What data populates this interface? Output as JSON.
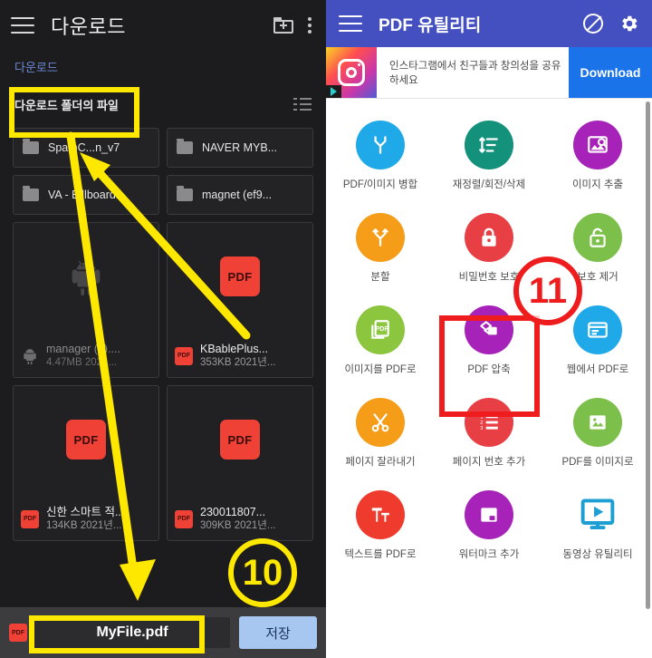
{
  "left_panel": {
    "appbar": {
      "title": "다운로드",
      "menu_icon": "hamburger-icon",
      "new_folder_icon": "new-folder-icon",
      "overflow_icon": "more-vertical-icon"
    },
    "breadcrumb": "다운로드",
    "subheader": {
      "label": "다운로드 폴더의 파일",
      "view_toggle_icon": "list-view-icon"
    },
    "folders": [
      {
        "name": "SpamC...n_v7"
      },
      {
        "name": "NAVER MYB..."
      },
      {
        "name": "VA - Billboard..."
      },
      {
        "name": "magnet (ef9..."
      }
    ],
    "files": [
      {
        "name": "manager (1)....",
        "meta": "4.47MB 2021...",
        "type": "apk",
        "dim": true
      },
      {
        "name": "KBablePlus...",
        "meta": "353KB 2021년...",
        "type": "pdf",
        "dim": false
      },
      {
        "name": "신한 스마트 적...",
        "meta": "134KB 2021년...",
        "type": "pdf",
        "dim": false
      },
      {
        "name": "230011807...",
        "meta": "309KB 2021년...",
        "type": "pdf",
        "dim": false
      }
    ],
    "save_bar": {
      "file_icon": "pdf-file-icon",
      "filename_value": "MyFile.pdf",
      "save_label": "저장"
    }
  },
  "right_panel": {
    "appbar": {
      "title": "PDF 유틸리티",
      "menu_icon": "hamburger-icon",
      "block_ads_icon": "no-ads-icon",
      "settings_icon": "gear-icon"
    },
    "ad": {
      "icon": "instagram-icon",
      "adchoices_icon": "adchoices-icon",
      "text": "인스타그램에서 친구들과 창의성을 공유하세요",
      "cta_label": "Download"
    },
    "tools": [
      {
        "label": "PDF/이미지 병합",
        "color": "#1fa9e8",
        "icon": "merge-icon"
      },
      {
        "label": "재정렬/회전/삭제",
        "color": "#13917a",
        "icon": "reorder-icon"
      },
      {
        "label": "이미지 추출",
        "color": "#a722b8",
        "icon": "extract-image-icon"
      },
      {
        "label": "분할",
        "color": "#f59c19",
        "icon": "split-icon"
      },
      {
        "label": "비밀번호 보호",
        "color": "#e83f45",
        "icon": "lock-icon"
      },
      {
        "label": "보호 제거",
        "color": "#7cc04b",
        "icon": "unlock-icon"
      },
      {
        "label": "이미지를 PDF로",
        "color": "#8cc63f",
        "icon": "image-to-pdf-icon"
      },
      {
        "label": "PDF 압축",
        "color": "#a722b8",
        "icon": "compress-pdf-icon"
      },
      {
        "label": "웹에서 PDF로",
        "color": "#1fa9e8",
        "icon": "web-to-pdf-icon"
      },
      {
        "label": "페이지 잘라내기",
        "color": "#f59c19",
        "icon": "scissors-icon"
      },
      {
        "label": "페이지 번호 추가",
        "color": "#e83f45",
        "icon": "numbered-list-icon"
      },
      {
        "label": "PDF를 이미지로",
        "color": "#7cc04b",
        "icon": "pdf-to-image-icon"
      },
      {
        "label": "텍스트를 PDF로",
        "color": "#ef3b2d",
        "icon": "text-to-pdf-icon"
      },
      {
        "label": "워터마크 추가",
        "color": "#a722b8",
        "icon": "watermark-icon"
      },
      {
        "label": "동영상 유틸리티",
        "color": "#1d9fd4",
        "icon": "video-utility-icon"
      }
    ],
    "scrollbar": "vertical-scrollbar"
  },
  "annotations": {
    "step_10": "10",
    "step_11": "11",
    "highlight_color": "#FFE800",
    "callout_color": "#EE1C1C"
  }
}
